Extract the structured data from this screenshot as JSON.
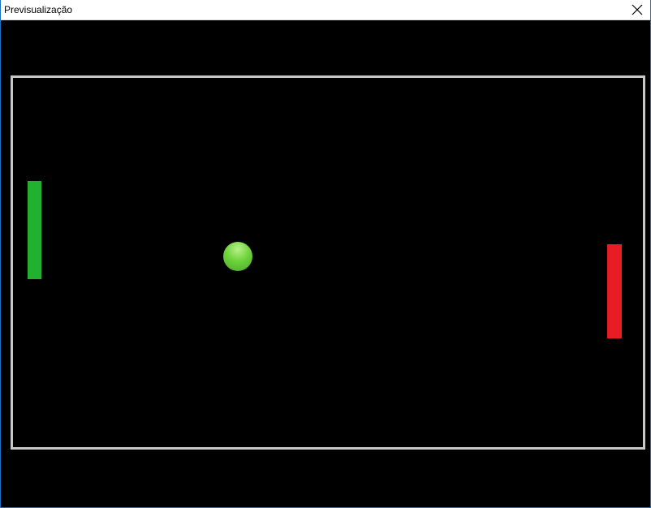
{
  "window": {
    "title": "Previsualização",
    "close_icon": "close-icon"
  },
  "game": {
    "background_color": "#000000",
    "court_border_color": "#c8c8c8",
    "left_paddle": {
      "color": "#22b030"
    },
    "right_paddle": {
      "color": "#e81c24"
    },
    "ball": {
      "color": "#6ed43c",
      "highlight_color": "#b8f08a"
    }
  }
}
